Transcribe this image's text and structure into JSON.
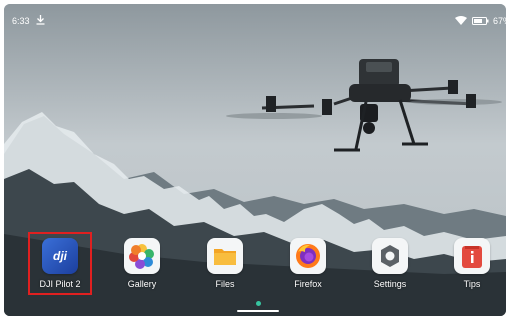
{
  "status_bar": {
    "time": "6:33",
    "battery": "67%",
    "download_icon": "download-arrow",
    "signal_icon": "wifi-signal",
    "battery_icon": "battery"
  },
  "apps": [
    {
      "label": "DJI Pilot 2",
      "icon": "dji-icon",
      "highlighted": true
    },
    {
      "label": "Gallery",
      "icon": "gallery-icon"
    },
    {
      "label": "Files",
      "icon": "files-icon"
    },
    {
      "label": "Firefox",
      "icon": "firefox-icon"
    },
    {
      "label": "Settings",
      "icon": "settings-icon"
    },
    {
      "label": "Tips",
      "icon": "tips-icon"
    }
  ],
  "colors": {
    "highlight": "#e02020",
    "page_indicator": "#37c5a0"
  }
}
